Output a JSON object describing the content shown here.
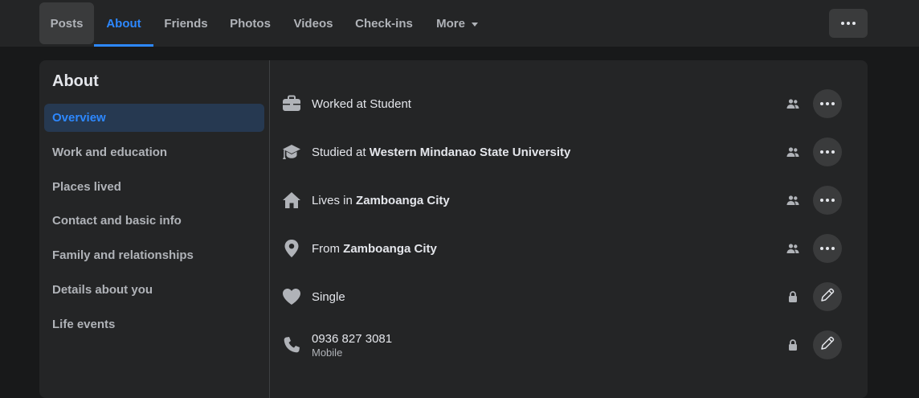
{
  "tabs": [
    {
      "label": "Posts"
    },
    {
      "label": "About"
    },
    {
      "label": "Friends"
    },
    {
      "label": "Photos"
    },
    {
      "label": "Videos"
    },
    {
      "label": "Check-ins"
    },
    {
      "label": "More"
    }
  ],
  "active_tab": "About",
  "sidebar": {
    "title": "About",
    "items": [
      {
        "label": "Overview"
      },
      {
        "label": "Work and education"
      },
      {
        "label": "Places lived"
      },
      {
        "label": "Contact and basic info"
      },
      {
        "label": "Family and relationships"
      },
      {
        "label": "Details about you"
      },
      {
        "label": "Life events"
      }
    ],
    "active": "Overview"
  },
  "overview": [
    {
      "icon": "briefcase-icon",
      "prefix": "Worked at Student",
      "bold": "",
      "audience": "friends-icon",
      "action": "more"
    },
    {
      "icon": "graduation-cap-icon",
      "prefix": "Studied at ",
      "bold": "Western Mindanao State University",
      "audience": "friends-icon",
      "action": "more"
    },
    {
      "icon": "home-icon",
      "prefix": "Lives in ",
      "bold": "Zamboanga City",
      "audience": "friends-icon",
      "action": "more"
    },
    {
      "icon": "location-pin-icon",
      "prefix": "From ",
      "bold": "Zamboanga City",
      "audience": "friends-icon",
      "action": "more"
    },
    {
      "icon": "heart-icon",
      "prefix": "Single",
      "bold": "",
      "audience": "lock-icon",
      "action": "edit"
    },
    {
      "icon": "phone-icon",
      "prefix": "0936 827 3081",
      "bold": "",
      "sub": "Mobile",
      "audience": "lock-icon",
      "action": "edit"
    }
  ],
  "colors": {
    "accent": "#2d88ff",
    "card": "#242526",
    "page": "#18191a",
    "icon": "#b0b3b8"
  }
}
